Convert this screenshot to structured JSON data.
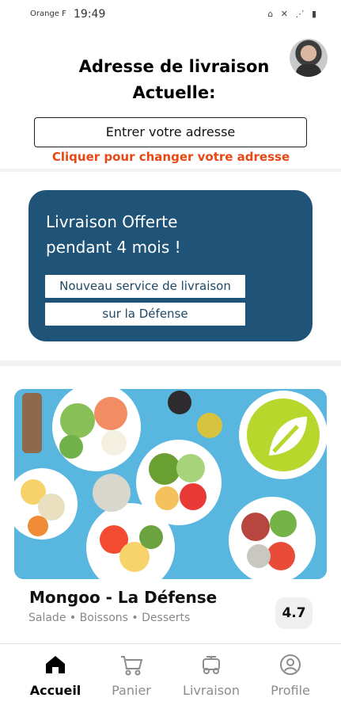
{
  "status_bar": {
    "carrier": "Orange F",
    "time": "19:49",
    "icons": "⌂ ✕ ⋰ ▮"
  },
  "header": {
    "title_line1": "Adresse de livraison",
    "title_line2": "Actuelle:",
    "address_button": "Entrer votre adresse",
    "change_link": "Cliquer pour changer votre adresse"
  },
  "promo": {
    "title_line1": "Livraison Offerte",
    "title_line2": "pendant 4 mois !",
    "line1": "Nouveau service de livraison",
    "line2": "sur la Défense",
    "background": "#1f5478"
  },
  "restaurant": {
    "name": "Mongoo - La Défense",
    "tags": "Salade • Boissons • Desserts",
    "rating": "4.7"
  },
  "nav": {
    "items": [
      {
        "label": "Accueil",
        "icon": "home-icon"
      },
      {
        "label": "Panier",
        "icon": "cart-icon"
      },
      {
        "label": "Livraison",
        "icon": "delivery-robot-icon"
      },
      {
        "label": "Profile",
        "icon": "profile-icon"
      }
    ]
  },
  "colors": {
    "accent": "#e94713",
    "promo": "#1f5478",
    "image_background": "#58b6df"
  }
}
